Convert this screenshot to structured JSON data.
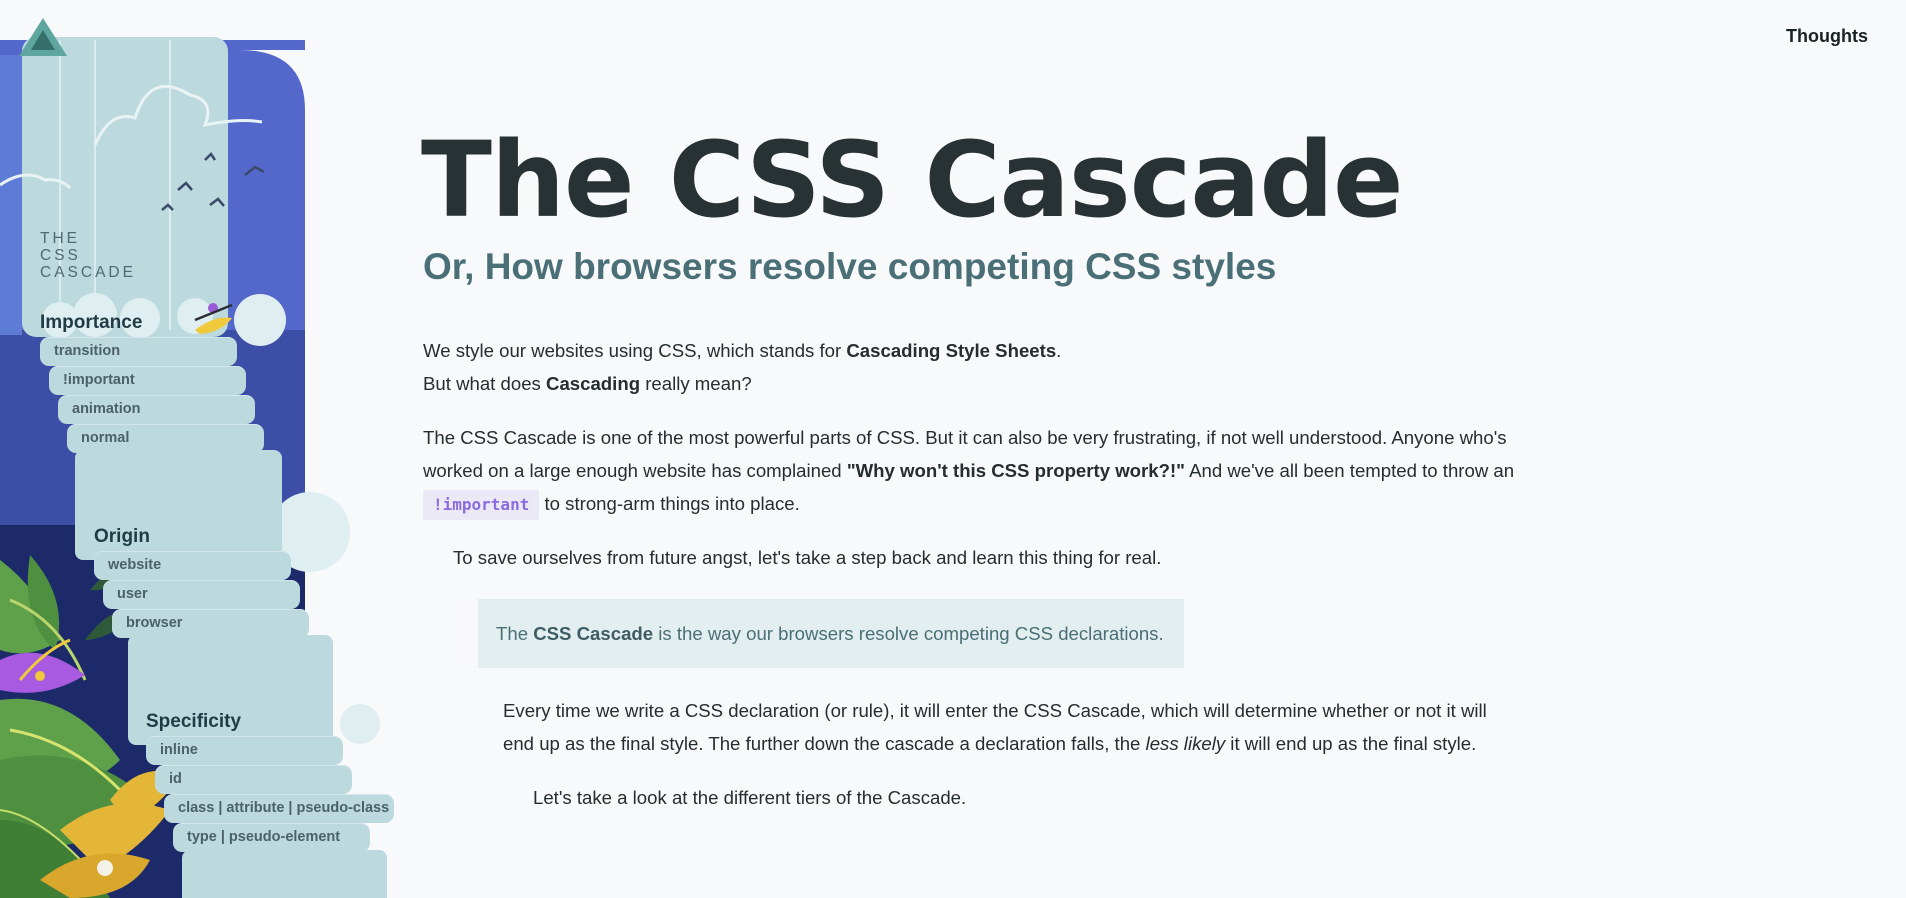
{
  "sidebar": {
    "title_lines": [
      "THE",
      "CSS",
      "CASCADE"
    ],
    "tiers": [
      {
        "heading": "Importance",
        "items": [
          "transition",
          "!important",
          "animation",
          "normal"
        ]
      },
      {
        "heading": "Origin",
        "items": [
          "website",
          "user",
          "browser"
        ]
      },
      {
        "heading": "Specificity",
        "items": [
          "inline",
          "id",
          "class | attribute | pseudo-class",
          "type | pseudo-element"
        ]
      }
    ]
  },
  "nav": {
    "thoughts_label": "Thoughts"
  },
  "header": {
    "title": "The CSS Cascade",
    "subtitle": "Or, How browsers resolve competing CSS styles"
  },
  "intro": {
    "line1_prefix": "We style our websites using CSS, which stands for ",
    "line1_bold": "Cascading Style Sheets",
    "line1_suffix": ".",
    "line2_prefix": "But what does ",
    "line2_bold": "Cascading",
    "line2_suffix": " really mean?"
  },
  "para2": {
    "line1": "The CSS Cascade is one of the most powerful parts of CSS. But it can also be very frustrating, if not well understood. Anyone who's",
    "line2_prefix": "worked on a large enough website has complained ",
    "line2_bold": "\"Why won't this CSS property work?!\"",
    "line2_suffix": " And we've all been tempted to throw an",
    "code": "!important",
    "line3_suffix": " to strong-arm things into place."
  },
  "para3": "To save ourselves from future angst, let's take a step back and learn this thing for real.",
  "callout": {
    "prefix": "The ",
    "bold": "CSS Cascade",
    "suffix": " is the way our browsers resolve competing CSS declarations."
  },
  "para4": {
    "line1": "Every time we write a CSS declaration (or rule), it will enter the CSS Cascade, which will determine whether or not it will",
    "line2_prefix": "end up as the final style. The further down the cascade a declaration falls, the ",
    "line2_italic": "less likely",
    "line2_suffix": " it will end up as the final style."
  },
  "para5": "Let's take a look at the different tiers of the Cascade.",
  "colors": {
    "background": "#f7f9fa",
    "title": "#283133",
    "subtitle": "#4b6f76",
    "callout_bg": "#e2eef0",
    "code_bg": "#ebe9f5",
    "code_text": "#8c6ae0",
    "waterfall": "#bcd9de",
    "sky_blue": "#5468cc",
    "deep_navy": "#1c2a6a"
  },
  "icons": [
    "logo-triangle-icon",
    "kayak-figure-icon",
    "birds-icon",
    "cloud-icon",
    "tropical-leaves-icon",
    "purple-flower-icon",
    "yellow-flower-icon"
  ]
}
